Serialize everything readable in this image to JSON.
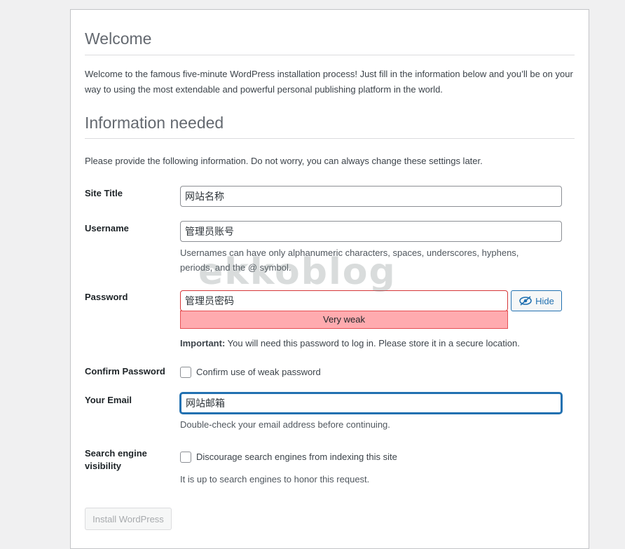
{
  "welcome": {
    "title": "Welcome",
    "intro": "Welcome to the famous five-minute WordPress installation process! Just fill in the information below and you’ll be on your way to using the most extendable and powerful personal publishing platform in the world."
  },
  "info": {
    "title": "Information needed",
    "intro": "Please provide the following information. Do not worry, you can always change these settings later."
  },
  "form": {
    "site_title": {
      "label": "Site Title",
      "value": "网站名称"
    },
    "username": {
      "label": "Username",
      "value": "管理员账号",
      "help": "Usernames can have only alphanumeric characters, spaces, underscores, hyphens, periods, and the @ symbol."
    },
    "password": {
      "label": "Password",
      "value": "管理员密码",
      "hide_label": "Hide",
      "strength": "Very weak",
      "important_label": "Important:",
      "important_text": " You will need this password to log in. Please store it in a secure location."
    },
    "confirm_password": {
      "label": "Confirm Password",
      "checkbox_label": "Confirm use of weak password",
      "checked": false
    },
    "email": {
      "label": "Your Email",
      "value": "网站邮箱",
      "help": "Double-check your email address before continuing."
    },
    "search_visibility": {
      "label": "Search engine visibility",
      "checkbox_label": "Discourage search engines from indexing this site",
      "checked": false,
      "help": "It is up to search engines to honor this request."
    },
    "submit_label": "Install WordPress"
  },
  "watermark": "ekkoblog",
  "colors": {
    "accent": "#2271b1",
    "weak_fill": "#ffabaf",
    "weak_border": "#d63638",
    "page_bg": "#f0f0f1"
  }
}
